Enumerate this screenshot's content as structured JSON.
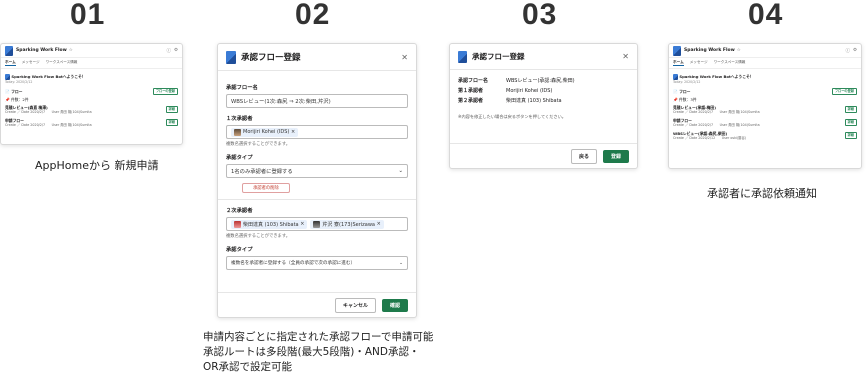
{
  "steps": {
    "s1": {
      "num": "01",
      "caption": "AppHomeから 新規申請"
    },
    "s2": {
      "num": "02",
      "caption_lines": [
        "申請内容ごとに指定された承認フローで申請可能",
        "承認ルートは多段階(最大5段階)・AND承認・",
        "OR承認で設定可能"
      ]
    },
    "s3": {
      "num": "03"
    },
    "s4": {
      "num": "04",
      "caption": "承認者に承認依頼通知"
    }
  },
  "home1": {
    "app_name": "Sparking Work Flow",
    "tabs": [
      "ホーム",
      "メッセージ",
      "ワークスペース情報"
    ],
    "welcome": "Sparking Work Flow Botへようこそ！",
    "today": "Today: 2020/2/12",
    "flow_label": "フロー",
    "flow_button": "フローの登録",
    "count": "件数：2件",
    "items": [
      {
        "title": "見積レビュー(森直 梅澤)",
        "meta": "Create ／ Date 2020/2/7　　User 角田 幌(104)Sumita",
        "button": "詳細"
      },
      {
        "title": "申請フロー",
        "meta": "Create ／ Date 2020/2/7　　User 角田 幌(104)Sumita",
        "button": "詳細"
      }
    ]
  },
  "modal2": {
    "title": "承認フロー登録",
    "flow_name_label": "承認フロー名",
    "flow_name_value": "WBSレビュー(1次:森尻 ⇒ 2次:柴田,芹沢)",
    "first_label": "１次承認者",
    "first_chips": [
      "Morijiri Kohei (IDS)"
    ],
    "multi_hint": "複数名選択することができます。",
    "type_label": "承認タイプ",
    "type1_value": "1名のみ承認者に登録する",
    "delete_button": "承認者の削除",
    "second_label": "２次承認者",
    "second_chips": [
      "柴田達真 (103) Shibata",
      "芹沢 寮(173)Serizawa"
    ],
    "type2_value": "複数名を承認者に登録する（全員の承認で次の承認に進む）",
    "cancel_button": "キャンセル",
    "confirm_button": "確認"
  },
  "modal3": {
    "title": "承認フロー登録",
    "rows": [
      {
        "key": "承認フロー名",
        "value": "WBSレビュー(承認:森尻,柴田)"
      },
      {
        "key": "第１承認者",
        "value": "Morijiri Kohei (IDS)"
      },
      {
        "key": "第２承認者",
        "value": "柴田達真 (103) Shibata"
      }
    ],
    "note": "※内容を修正したい場合は戻るボタンを押してください。",
    "back_button": "戻る",
    "register_button": "登録"
  },
  "home4": {
    "app_name": "Sparking Work Flow",
    "tabs": [
      "ホーム",
      "メッセージ",
      "ワークスペース情報"
    ],
    "welcome": "Sparking Work Flow Botへようこそ！",
    "today": "Today: 2020/2/12",
    "flow_label": "フロー",
    "flow_button": "フローの登録",
    "count": "件数：3件",
    "items": [
      {
        "title": "見積レビュー(承認:梅田)",
        "meta": "Create ／ Date 2020/2/7　　User 角田 幌(104)Sumita",
        "button": "詳細"
      },
      {
        "title": "申請フロー",
        "meta": "Create ／ Date 2020/2/7　　User 角田 幌(104)Sumita",
        "button": "詳細"
      },
      {
        "title": "WBSレビュー(承認:森尻,柴田)",
        "meta": "Create ／ Date 2020/2/12　　User oski(藤谷)",
        "button": "詳細"
      }
    ]
  },
  "colors": {
    "accent_green": "#1e7a4b",
    "danger": "#c0392b",
    "chip_bg": "#e8f0fb"
  }
}
